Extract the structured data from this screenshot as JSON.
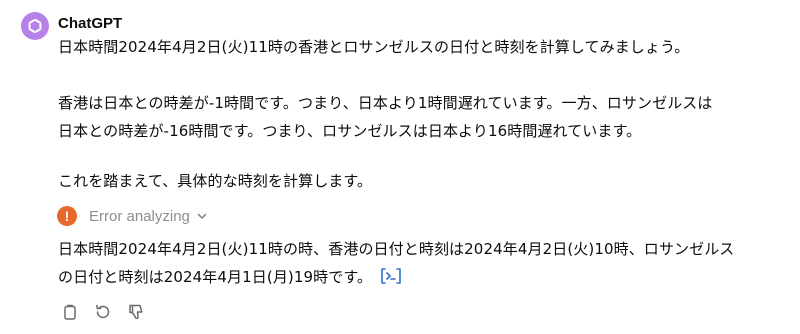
{
  "message": {
    "sender": "ChatGPT",
    "avatar_icon": "openai-logo-icon",
    "avatar_color": "#b682e9",
    "paragraphs": [
      {
        "lines": [
          "日本時間2024年4月2日(火)11時の香港とロサンゼルスの日付と時刻を計算してみましょう。"
        ]
      },
      {
        "lines": [
          "香港は日本との時差が-1時間です。つまり、日本より1時間遅れています。一方、ロサンゼルスは",
          "日本との時差が-16時間です。つまり、ロサンゼルスは日本より16時間遅れています。"
        ]
      },
      {
        "lines": [
          "これを踏まえて、具体的な時刻を計算します。"
        ]
      }
    ],
    "analysis": {
      "icon": "error-exclamation-icon",
      "icon_color": "#e8682b",
      "label": "Error analyzing",
      "toggle_icon": "chevron-down-icon"
    },
    "result": {
      "lines": [
        "日本時間2024年4月2日(火)11時の時、香港の日付と時刻は2024年4月2日(火)10時、ロサンゼルス",
        "の日付と時刻は2024年4月1日(月)19時です。"
      ],
      "code_link_icon": "view-analysis-code-icon",
      "code_link_color": "#2f6fd0"
    },
    "actions": [
      {
        "name": "copy-button",
        "icon": "copy-icon"
      },
      {
        "name": "regenerate-button",
        "icon": "regenerate-icon"
      },
      {
        "name": "thumbs-down-button",
        "icon": "thumbs-down-icon"
      }
    ]
  }
}
